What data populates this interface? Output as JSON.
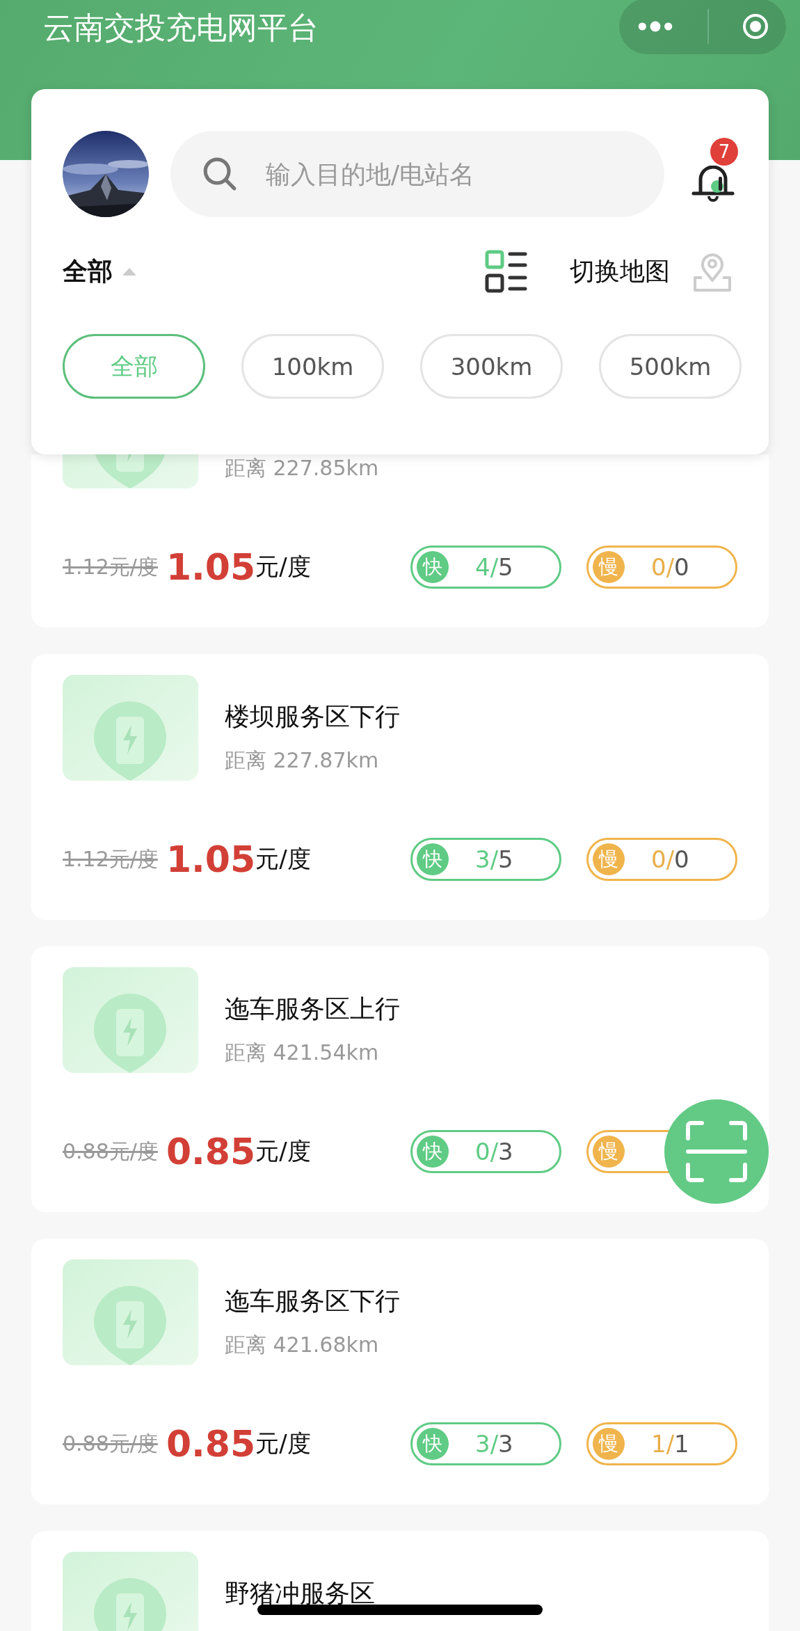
{
  "header": {
    "title": "云南交投充电网平台"
  },
  "panel": {
    "search": {
      "placeholder": "输入目的地/电站名"
    },
    "notification_count": "7",
    "filter": {
      "label": "全部"
    },
    "switch_map": {
      "label": "切换地图"
    },
    "chips": [
      {
        "label": "全部",
        "selected": true
      },
      {
        "label": "100km",
        "selected": false
      },
      {
        "label": "300km",
        "selected": false
      },
      {
        "label": "500km",
        "selected": false
      }
    ]
  },
  "stations": [
    {
      "distance": "距离 227.85km",
      "original_price": "1.12元/度",
      "price": "1.05",
      "unit": "元/度",
      "fast": {
        "label": "快",
        "used": "4",
        "separator": "/",
        "total": "5"
      },
      "slow": {
        "label": "慢",
        "used": "0",
        "separator": "/",
        "total": "0"
      }
    },
    {
      "name": "楼坝服务区下行",
      "distance": "距离 227.87km",
      "original_price": "1.12元/度",
      "price": "1.05",
      "unit": "元/度",
      "fast": {
        "label": "快",
        "used": "3",
        "separator": "/",
        "total": "5"
      },
      "slow": {
        "label": "慢",
        "used": "0",
        "separator": "/",
        "total": "0"
      }
    },
    {
      "name": "迤车服务区上行",
      "distance": "距离 421.54km",
      "original_price": "0.88元/度",
      "price": "0.85",
      "unit": "元/度",
      "fast": {
        "label": "快",
        "used": "0",
        "separator": "/",
        "total": "3"
      },
      "slow": {
        "label": "慢"
      }
    },
    {
      "name": "迤车服务区下行",
      "distance": "距离 421.68km",
      "original_price": "0.88元/度",
      "price": "0.85",
      "unit": "元/度",
      "fast": {
        "label": "快",
        "used": "3",
        "separator": "/",
        "total": "3"
      },
      "slow": {
        "label": "慢",
        "used": "1",
        "separator": "/",
        "total": "1"
      }
    },
    {
      "name": "野猪冲服务区"
    }
  ]
}
